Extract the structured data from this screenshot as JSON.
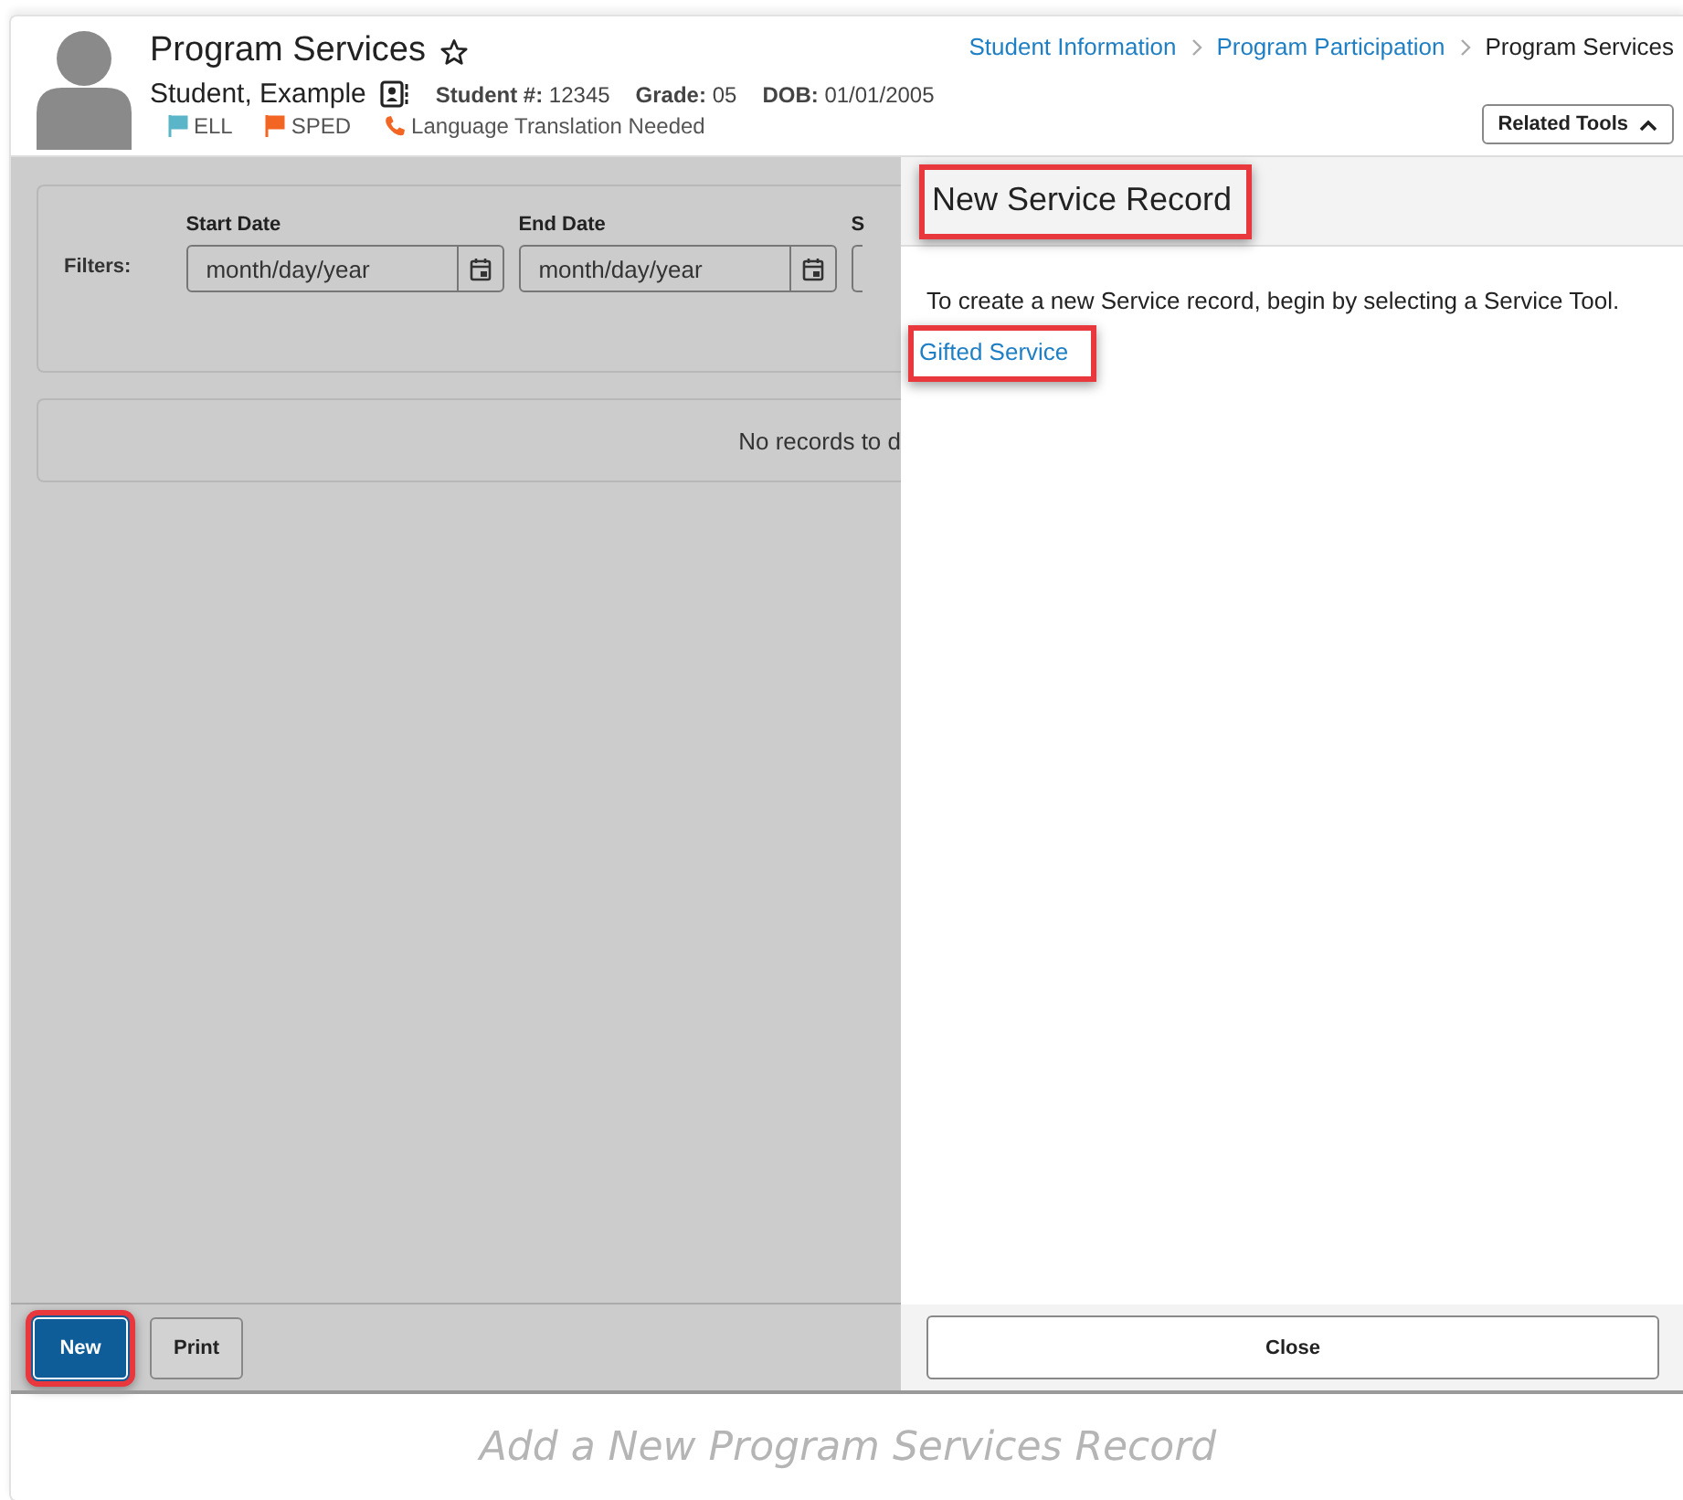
{
  "header": {
    "title": "Program Services",
    "student_name": "Student, Example",
    "fields": [
      {
        "label": "Student #:",
        "value": "12345"
      },
      {
        "label": "Grade:",
        "value": "05"
      },
      {
        "label": "DOB:",
        "value": "01/01/2005"
      }
    ],
    "flags": [
      {
        "label": "ELL",
        "kind": "flag",
        "color": "#5bb5c8"
      },
      {
        "label": "SPED",
        "kind": "flag",
        "color": "#f26522"
      },
      {
        "label": "Language Translation Needed",
        "kind": "phone",
        "color": "#f26522"
      }
    ],
    "breadcrumbs": [
      {
        "label": "Student Information",
        "kind": "link"
      },
      {
        "label": "Program Participation",
        "kind": "link"
      },
      {
        "label": "Program Services",
        "kind": "current"
      }
    ],
    "related_tools": {
      "label": "Related Tools",
      "expanded": true
    }
  },
  "filters": {
    "label": "Filters:",
    "fields": [
      {
        "label": "Start Date",
        "placeholder": "month/day/year"
      },
      {
        "label": "End Date",
        "placeholder": "month/day/year"
      },
      {
        "label": "S"
      }
    ]
  },
  "empty_message": "No records to d",
  "buttons": [
    {
      "label": "New",
      "kind": "primary",
      "highlighted": true
    },
    {
      "label": "Print",
      "kind": "secondary",
      "highlighted": false
    }
  ],
  "panel": {
    "title": "New Service Record",
    "title_highlighted": true,
    "instruction": "To create a new Service record, begin by selecting a Service Tool.",
    "tools": [
      {
        "label": "Gifted Service",
        "highlighted": true
      }
    ],
    "close": "Close"
  },
  "caption": "Add a New Program Services Record"
}
